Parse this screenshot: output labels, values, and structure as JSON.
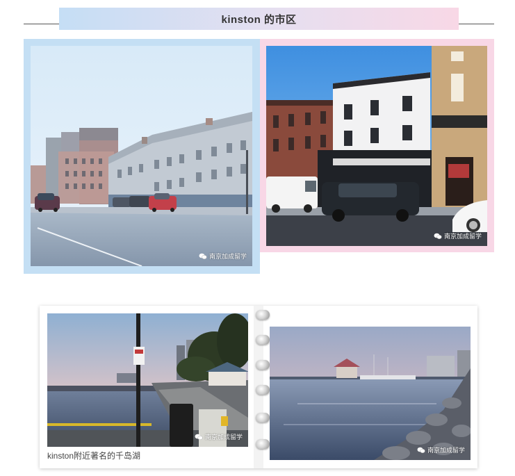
{
  "header": {
    "title": "kinston 的市区"
  },
  "watermark": {
    "text": "南京加成留学"
  },
  "lake_caption": "kinston附近著名的千岛湖",
  "colors": {
    "frame_blue": "#c4dff4",
    "frame_pink": "#f8d7e6",
    "banner_left": "#c5def5",
    "banner_right": "#f8d8e6"
  }
}
